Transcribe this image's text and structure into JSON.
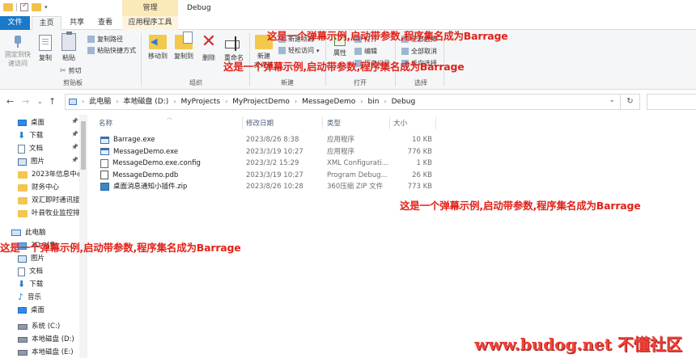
{
  "titlebar": {
    "manage_tab": "管理",
    "window_title": "Debug"
  },
  "tabs": {
    "file": "文件",
    "home": "主页",
    "share": "共享",
    "view": "查看",
    "app_tools": "应用程序工具"
  },
  "ribbon": {
    "clipboard": {
      "pin_label_1": "固定到快",
      "pin_label_2": "速访问",
      "copy": "复制",
      "paste": "粘贴",
      "copy_path": "复制路径",
      "paste_shortcut": "粘贴快捷方式",
      "cut": "剪切",
      "group": "剪贴板"
    },
    "organize": {
      "move_to": "移动到",
      "copy_to": "复制到",
      "delete": "删除",
      "rename": "重命名",
      "group": "组织"
    },
    "new": {
      "new_folder_1": "新建",
      "new_folder_2": "文件夹",
      "new_item": "新建项目",
      "easy_access": "轻松访问",
      "group": "新建"
    },
    "open": {
      "properties": "属性",
      "open": "打开",
      "edit": "编辑",
      "history": "历史记录",
      "group": "打开"
    },
    "select": {
      "select_all": "全部选择",
      "select_none": "全部取消",
      "invert": "反向选择",
      "group": "选择"
    }
  },
  "address": {
    "segments": [
      "此电脑",
      "本地磁盘 (D:)",
      "MyProjects",
      "MyProjectDemo",
      "MessageDemo",
      "bin",
      "Debug"
    ]
  },
  "nav": {
    "items": [
      {
        "label": "桌面",
        "icon": "desktop-icon",
        "pinned": true
      },
      {
        "label": "下载",
        "icon": "download-icon",
        "pinned": true
      },
      {
        "label": "文档",
        "icon": "document-icon",
        "pinned": true
      },
      {
        "label": "图片",
        "icon": "picture-icon",
        "pinned": true
      },
      {
        "label": "2023年信息中心",
        "icon": "folder-icon",
        "pinned": false
      },
      {
        "label": "财务中心",
        "icon": "folder-icon",
        "pinned": false
      },
      {
        "label": "双汇即时通讯接(",
        "icon": "folder-icon",
        "pinned": false
      },
      {
        "label": "叶县牧业监控排:",
        "icon": "folder-icon",
        "pinned": false
      },
      {
        "label": "此电脑",
        "icon": "this-pc-icon",
        "pinned": false
      },
      {
        "label": "3D 对象",
        "icon": "3d-objects-icon",
        "pinned": false
      },
      {
        "label": "图片",
        "icon": "picture-icon",
        "pinned": false
      },
      {
        "label": "文档",
        "icon": "document-icon",
        "pinned": false
      },
      {
        "label": "下载",
        "icon": "download-icon",
        "pinned": false
      },
      {
        "label": "音乐",
        "icon": "music-icon",
        "pinned": false
      },
      {
        "label": "桌面",
        "icon": "desktop-icon",
        "pinned": false
      },
      {
        "label": "系统 (C:)",
        "icon": "drive-icon",
        "pinned": false
      },
      {
        "label": "本地磁盘 (D:)",
        "icon": "drive-icon",
        "pinned": false
      },
      {
        "label": "本地磁盘 (E:)",
        "icon": "drive-icon",
        "pinned": false
      }
    ]
  },
  "filelist": {
    "headers": {
      "name": "名称",
      "date": "修改日期",
      "type": "类型",
      "size": "大小"
    },
    "rows": [
      {
        "name": "Barrage.exe",
        "date": "2023/8/26 8:38",
        "type": "应用程序",
        "size": "10 KB",
        "icon": "exe"
      },
      {
        "name": "MessageDemo.exe",
        "date": "2023/3/19 10:27",
        "type": "应用程序",
        "size": "776 KB",
        "icon": "exe"
      },
      {
        "name": "MessageDemo.exe.config",
        "date": "2023/3/2 15:29",
        "type": "XML Configurati...",
        "size": "1 KB",
        "icon": "cfg"
      },
      {
        "name": "MessageDemo.pdb",
        "date": "2023/3/19 10:27",
        "type": "Program Debug...",
        "size": "26 KB",
        "icon": "pdb"
      },
      {
        "name": "桌面消息通知小插件.zip",
        "date": "2023/8/26 10:28",
        "type": "360压缩 ZIP 文件",
        "size": "773 KB",
        "icon": "zip"
      }
    ]
  },
  "overlays": {
    "text": "这是一个弹幕示例,启动带参数,程序集名成为Barrage",
    "watermark": "www.budog.net 不懂社区"
  },
  "colors": {
    "accent": "#1979ca",
    "overlay_red": "#e1231a",
    "manage_tab": "#fce9b8"
  }
}
